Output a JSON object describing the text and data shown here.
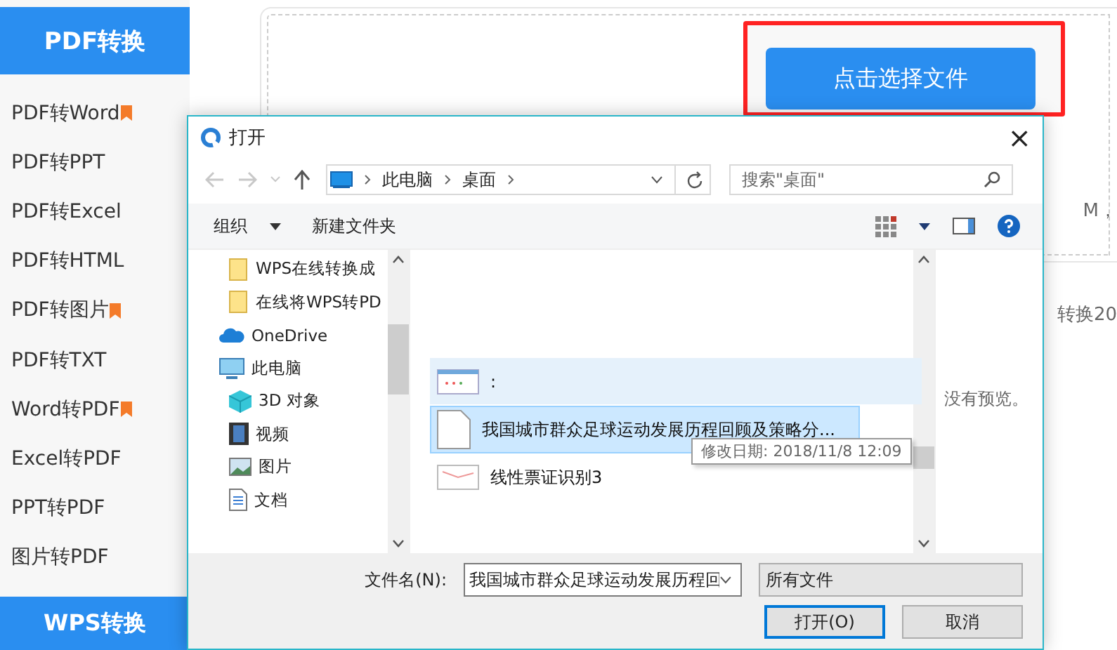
{
  "sidebar": {
    "header": "PDF转换",
    "items": [
      {
        "label": "PDF转Word",
        "hot": true
      },
      {
        "label": "PDF转PPT",
        "hot": false
      },
      {
        "label": "PDF转Excel",
        "hot": false
      },
      {
        "label": "PDF转HTML",
        "hot": false
      },
      {
        "label": "PDF转图片",
        "hot": true
      },
      {
        "label": "PDF转TXT",
        "hot": false
      },
      {
        "label": "Word转PDF",
        "hot": true
      },
      {
        "label": "Excel转PDF",
        "hot": false
      },
      {
        "label": "PPT转PDF",
        "hot": false
      },
      {
        "label": "图片转PDF",
        "hot": false
      }
    ],
    "footer": "WPS转换"
  },
  "main": {
    "select_button": "点击选择文件",
    "side_texts": [
      "M，",
      "转换20"
    ]
  },
  "dialog": {
    "title": "打开",
    "close": "×",
    "address": {
      "crumbs": [
        "此电脑",
        "桌面"
      ]
    },
    "search": {
      "placeholder": "搜索\"桌面\""
    },
    "toolbar": {
      "organize": "组织",
      "new_folder": "新建文件夹"
    },
    "nav": [
      {
        "children": [
          {
            "label": "WPS在线转换成",
            "kind": "folder"
          },
          {
            "label": "在线将WPS转PD",
            "kind": "folder"
          }
        ]
      },
      {
        "label": "OneDrive",
        "kind": "cloud"
      },
      {
        "label": "此电脑",
        "kind": "pc",
        "children": [
          {
            "label": "3D 对象",
            "kind": "cube"
          },
          {
            "label": "视频",
            "kind": "video"
          },
          {
            "label": "图片",
            "kind": "picture"
          },
          {
            "label": "文档",
            "kind": "document"
          }
        ]
      }
    ],
    "files": [
      {
        "name": ":",
        "kind": "window",
        "selected": false
      },
      {
        "name": "我国城市群众足球运动发展历程回顾及策略分...",
        "kind": "blank",
        "selected": true
      },
      {
        "name": "线性票证识别3",
        "kind": "image",
        "selected": false
      }
    ],
    "tooltip": "修改日期: 2018/11/8 12:09",
    "preview": "没有预览。",
    "filename_label": "文件名(N):",
    "filename": "我国城市群众足球运动发展历程回",
    "filetype": "所有文件",
    "buttons": [
      {
        "label": "打开(O)",
        "primary": true
      },
      {
        "label": "取消",
        "primary": false
      }
    ]
  }
}
